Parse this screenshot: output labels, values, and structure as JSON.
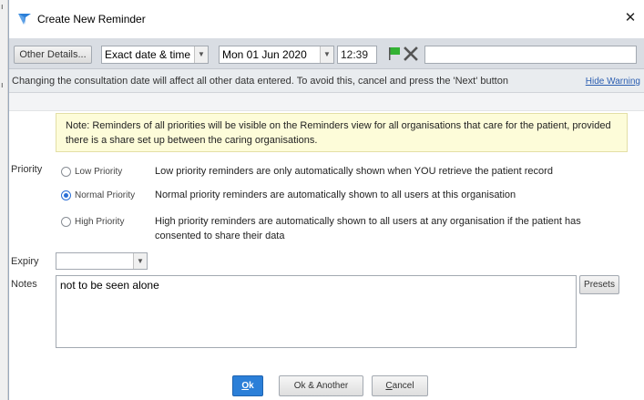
{
  "window": {
    "title": "Create New Reminder"
  },
  "toolbar": {
    "other_details": "Other Details...",
    "date_type": "Exact date & time",
    "date_value": "Mon 01 Jun 2020",
    "time_value": "12:39",
    "free_text_value": ""
  },
  "warning": {
    "text": "Changing the consultation date will affect all other data entered. To avoid this, cancel and press the 'Next' button",
    "hide_link": "Hide Warning"
  },
  "note": {
    "text": "Note: Reminders of all priorities will be visible on the Reminders view for all organisations that care for the patient, provided there is a share set up between the caring organisations."
  },
  "priority": {
    "label": "Priority",
    "selected": "normal",
    "options": [
      {
        "id": "low",
        "label": "Low Priority",
        "description": "Low priority reminders are only automatically shown when YOU retrieve the patient record"
      },
      {
        "id": "normal",
        "label": "Normal Priority",
        "description": "Normal priority reminders are automatically shown to all users at this organisation"
      },
      {
        "id": "high",
        "label": "High Priority",
        "description": "High priority reminders are automatically shown to all users at any organisation if the patient has consented to share their data"
      }
    ]
  },
  "expiry": {
    "label": "Expiry",
    "value": ""
  },
  "notes": {
    "label": "Notes",
    "value": "not to be seen alone",
    "presets": "Presets"
  },
  "buttons": {
    "ok_mnemonic": "O",
    "ok_rest": "k",
    "ok_another": "Ok & Another",
    "cancel_mnemonic": "C",
    "cancel_rest": "ancel"
  },
  "colors": {
    "accent": "#2b7fd8",
    "note_bg": "#fdfcd9",
    "flag": "#33b233"
  },
  "icons": {
    "app": "app-logo-icon",
    "close": "close-icon",
    "flag": "flag-icon",
    "clear": "clear-x-icon"
  }
}
